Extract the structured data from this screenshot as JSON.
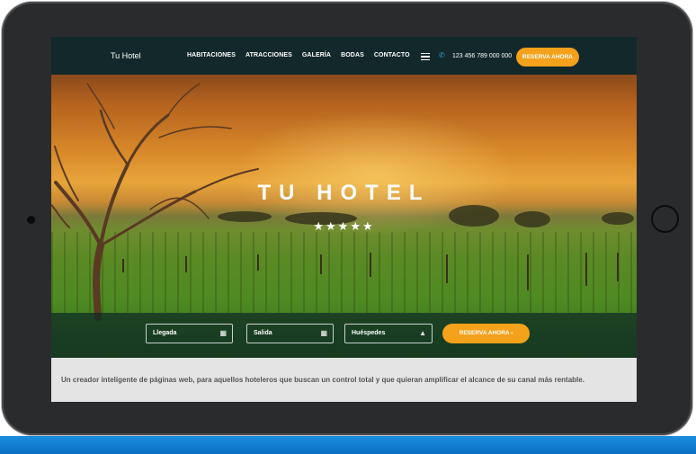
{
  "navbar": {
    "brand": "Tu Hotel",
    "menu": [
      "HABITACIONES",
      "ATRACCIONES",
      "GALERÍA",
      "BODAS",
      "CONTACTO"
    ],
    "phone": "123 456 789 000 000",
    "cta_label": "RESERVA AHORA"
  },
  "hero": {
    "title": "TU HOTEL",
    "stars": "★★★★★",
    "rating": 5
  },
  "search": {
    "arrival_label": "Llegada",
    "departure_label": "Salida",
    "guests_label": "Huéspedes",
    "cta_label": "RESERVA AHORA ›"
  },
  "tagline": "Un creador inteligente de páginas web, para aquellos hoteleros que buscan un control total y que quieran amplificar el alcance de su canal más rentable.",
  "icons": {
    "hamburger": "menu-icon",
    "phone": "phone-icon",
    "calendar": "calendar-icon",
    "user": "user-icon"
  },
  "colors": {
    "accent": "#f4a11b",
    "navbar": "#13282a",
    "phone_icon": "#29a3dd"
  }
}
